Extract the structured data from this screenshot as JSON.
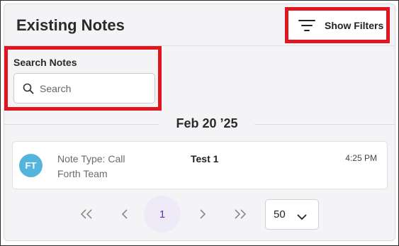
{
  "header": {
    "title": "Existing Notes",
    "filters_button_label": "Show Filters",
    "filters_icon": "filter-lines-icon"
  },
  "search": {
    "label": "Search Notes",
    "placeholder": "Search",
    "value": "",
    "icon": "search-icon"
  },
  "date_group": {
    "date": "Feb 20 ’25"
  },
  "notes": [
    {
      "avatar_initials": "FT",
      "note_type": "Note Type: Call",
      "team": "Forth Team",
      "title": "Test 1",
      "time": "4:25 PM"
    }
  ],
  "pagination": {
    "first_icon": "«",
    "prev_icon": "‹",
    "current_page": "1",
    "next_icon": "›",
    "last_icon": "»",
    "per_page": "50"
  },
  "colors": {
    "highlight_red": "#e0161e",
    "avatar_blue": "#55b4dc",
    "active_page_bg": "#efeaf8",
    "active_page_text": "#6b2fa6"
  }
}
